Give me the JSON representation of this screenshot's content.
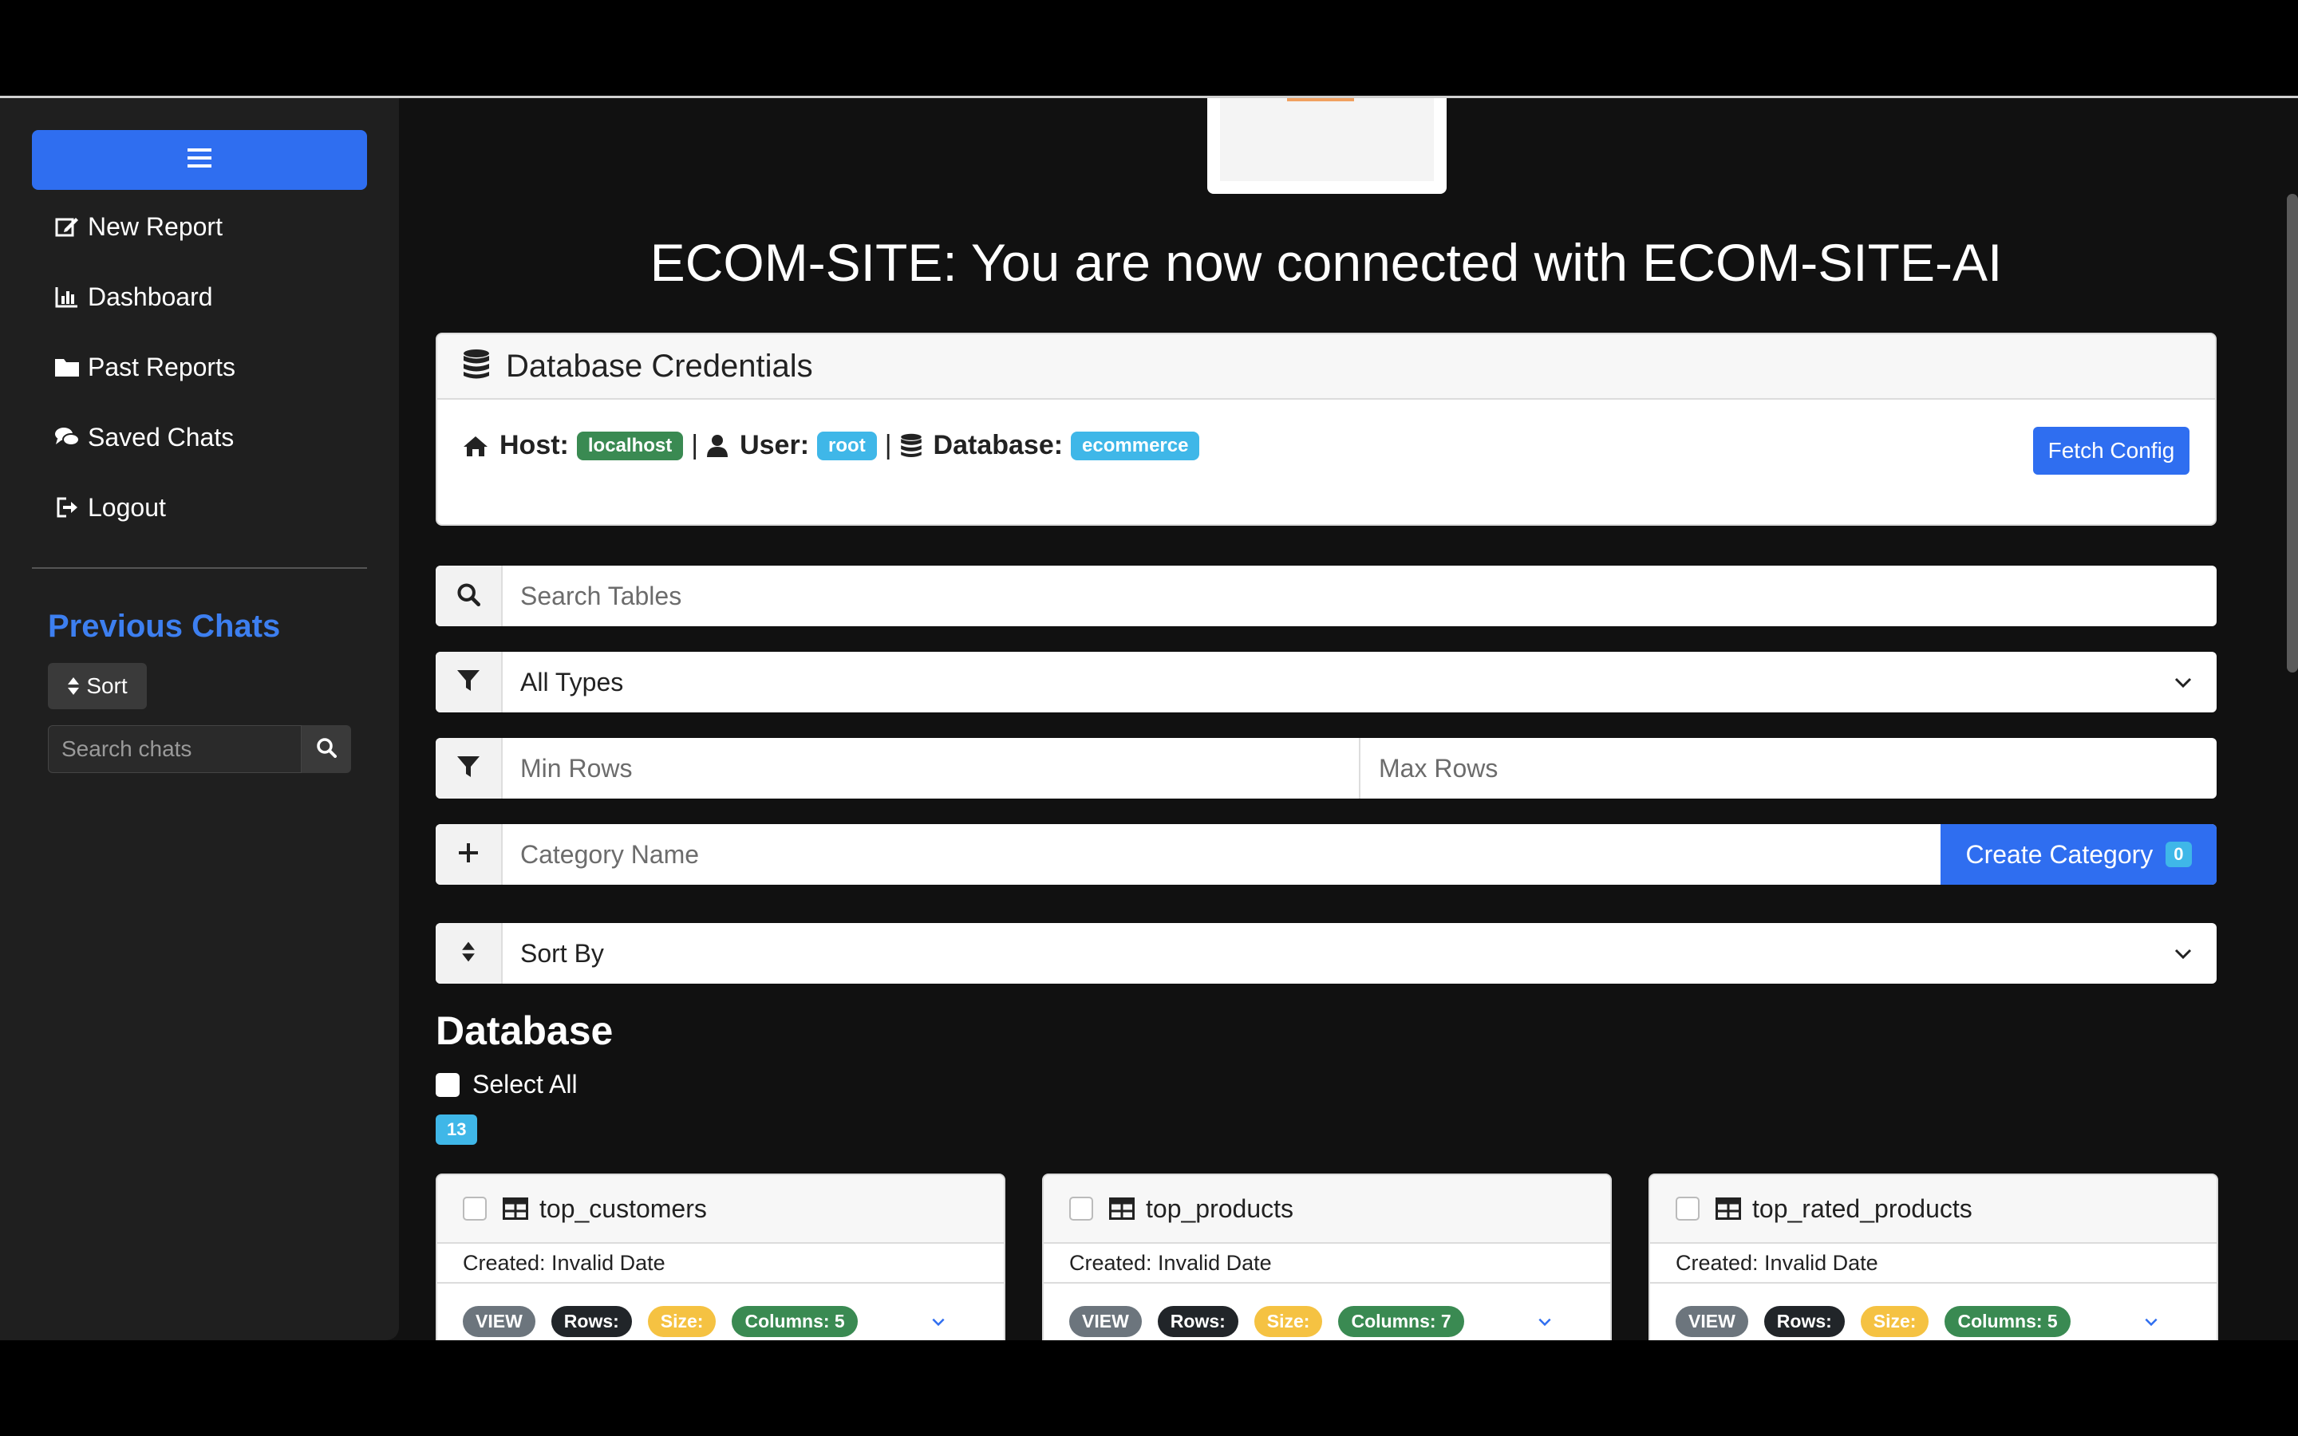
{
  "sidebar": {
    "nav": [
      {
        "label": "New Report",
        "icon": "edit-icon"
      },
      {
        "label": "Dashboard",
        "icon": "chart-icon"
      },
      {
        "label": "Past Reports",
        "icon": "folder-icon"
      },
      {
        "label": "Saved Chats",
        "icon": "comments-icon"
      },
      {
        "label": "Logout",
        "icon": "logout-icon"
      }
    ],
    "previous_chats_title": "Previous Chats",
    "sort_label": "Sort",
    "search_placeholder": "Search chats"
  },
  "main": {
    "headline": "ECOM-SITE: You are now connected with ECOM-SITE-AI",
    "credentials": {
      "title": "Database Credentials",
      "host_label": "Host:",
      "host": "localhost",
      "user_label": "User:",
      "user": "root",
      "database_label": "Database:",
      "database": "ecommerce",
      "separator": "|",
      "fetch_label": "Fetch Config"
    },
    "search_tables_placeholder": "Search Tables",
    "type_filter_value": "All Types",
    "min_rows_placeholder": "Min Rows",
    "max_rows_placeholder": "Max Rows",
    "category_placeholder": "Category Name",
    "create_category_label": "Create Category",
    "create_category_count": "0",
    "sort_by_value": "Sort By",
    "database_title": "Database",
    "select_all_label": "Select All",
    "table_count": "13",
    "tables": [
      {
        "name": "top_customers",
        "created": "Created: Invalid Date",
        "type": "VIEW",
        "rows": "Rows:",
        "size": "Size:",
        "columns": "Columns: 5"
      },
      {
        "name": "top_products",
        "created": "Created: Invalid Date",
        "type": "VIEW",
        "rows": "Rows:",
        "size": "Size:",
        "columns": "Columns: 7"
      },
      {
        "name": "top_rated_products",
        "created": "Created: Invalid Date",
        "type": "VIEW",
        "rows": "Rows:",
        "size": "Size:",
        "columns": "Columns: 5"
      }
    ]
  },
  "colors": {
    "accent": "#2f6ef0",
    "host_badge": "#3a8a52",
    "info_badge": "#3fb7e8",
    "view_pill": "#6c757d",
    "rows_pill": "#212529",
    "size_pill": "#f5c242",
    "columns_pill": "#3a8a52"
  }
}
